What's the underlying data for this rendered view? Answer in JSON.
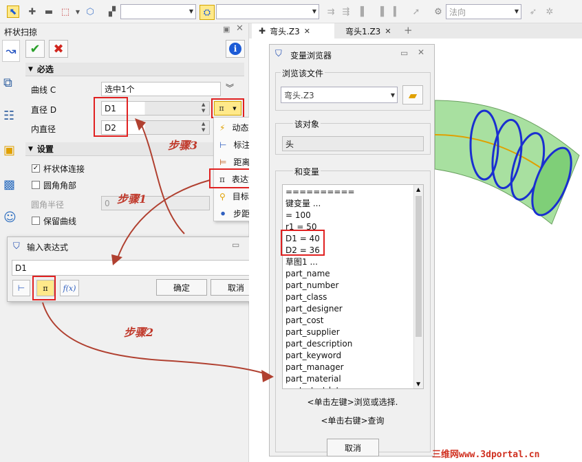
{
  "toolbar": {
    "combo1_value": "",
    "combo2_value": "",
    "combo3_value": "法向"
  },
  "tabs": [
    {
      "label": "弯头.Z3",
      "active": true
    },
    {
      "label": "弯头1.Z3",
      "active": false
    }
  ],
  "left_panel": {
    "title": "杆状扫掠",
    "required_section": "必选",
    "curve_label": "曲线 C",
    "curve_value": "选中1个",
    "diameter_label": "直径 D",
    "diameter_value": "D1",
    "inner_diameter_label": "内直径",
    "inner_diameter_value": "D2",
    "settings_section": "设置",
    "rod_body_connect": "杆状体连接",
    "rod_body_connect_checked": true,
    "fillet_corner": "圆角角部",
    "fillet_corner_checked": false,
    "fillet_radius_label": "圆角半径",
    "fillet_radius_value": "0",
    "keep_curve": "保留曲线",
    "keep_curve_checked": false
  },
  "dropdown_menu": {
    "items": [
      "动态输入",
      "标注值",
      "距离",
      "表达式",
      "目标点",
      "步距"
    ]
  },
  "expression_dialog": {
    "title": "输入表达式",
    "value": "D1",
    "ok_label": "确定",
    "cancel_label": "取消"
  },
  "var_browser": {
    "title": "变量浏览器",
    "browse_file_label": "浏览该文件",
    "file_value": "弯头.Z3",
    "object_label": "该对象",
    "object_value": "头",
    "vars_label": "和变量",
    "list": [
      "==========",
      "键变量 ...",
      "= 100",
      "r1 = 50",
      "D1 = 40",
      "D2 = 36",
      "草图1 ...",
      "part_name",
      "part_number",
      "part_class",
      "part_designer",
      "part_cost",
      "part_supplier",
      "part_description",
      "part_keyword",
      "part_manager",
      "part_material",
      "part_startdate"
    ],
    "hint_left": "<单击左键>浏览或选择.",
    "hint_right": "<单击右键>查询",
    "cancel_label": "取消"
  },
  "annotations": {
    "step1": "步骤1",
    "step2": "步骤2",
    "step3": "步骤3"
  },
  "watermark": "三维网www.3dportal.cn",
  "colors": {
    "accent": "#e02020",
    "ok_green": "#2aa02a",
    "cancel_red": "#d0241c",
    "annotation": "#c0392b",
    "pipe_green": "#a8e0a0",
    "pipe_ring": "#1a2fd0"
  }
}
